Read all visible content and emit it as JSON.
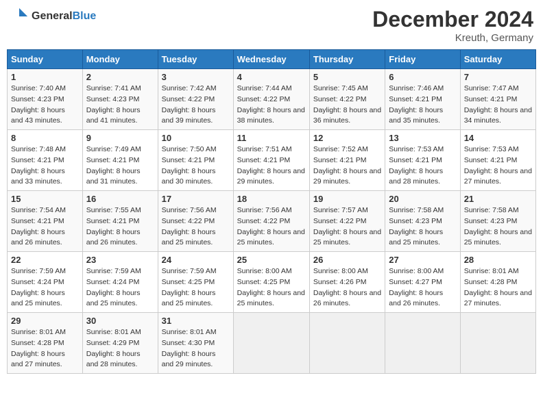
{
  "header": {
    "logo_general": "General",
    "logo_blue": "Blue",
    "month_title": "December 2024",
    "location": "Kreuth, Germany"
  },
  "weekdays": [
    "Sunday",
    "Monday",
    "Tuesday",
    "Wednesday",
    "Thursday",
    "Friday",
    "Saturday"
  ],
  "weeks": [
    [
      {
        "day": "1",
        "sunrise": "7:40 AM",
        "sunset": "4:23 PM",
        "daylight": "8 hours and 43 minutes."
      },
      {
        "day": "2",
        "sunrise": "7:41 AM",
        "sunset": "4:23 PM",
        "daylight": "8 hours and 41 minutes."
      },
      {
        "day": "3",
        "sunrise": "7:42 AM",
        "sunset": "4:22 PM",
        "daylight": "8 hours and 39 minutes."
      },
      {
        "day": "4",
        "sunrise": "7:44 AM",
        "sunset": "4:22 PM",
        "daylight": "8 hours and 38 minutes."
      },
      {
        "day": "5",
        "sunrise": "7:45 AM",
        "sunset": "4:22 PM",
        "daylight": "8 hours and 36 minutes."
      },
      {
        "day": "6",
        "sunrise": "7:46 AM",
        "sunset": "4:21 PM",
        "daylight": "8 hours and 35 minutes."
      },
      {
        "day": "7",
        "sunrise": "7:47 AM",
        "sunset": "4:21 PM",
        "daylight": "8 hours and 34 minutes."
      }
    ],
    [
      {
        "day": "8",
        "sunrise": "7:48 AM",
        "sunset": "4:21 PM",
        "daylight": "8 hours and 33 minutes."
      },
      {
        "day": "9",
        "sunrise": "7:49 AM",
        "sunset": "4:21 PM",
        "daylight": "8 hours and 31 minutes."
      },
      {
        "day": "10",
        "sunrise": "7:50 AM",
        "sunset": "4:21 PM",
        "daylight": "8 hours and 30 minutes."
      },
      {
        "day": "11",
        "sunrise": "7:51 AM",
        "sunset": "4:21 PM",
        "daylight": "8 hours and 29 minutes."
      },
      {
        "day": "12",
        "sunrise": "7:52 AM",
        "sunset": "4:21 PM",
        "daylight": "8 hours and 29 minutes."
      },
      {
        "day": "13",
        "sunrise": "7:53 AM",
        "sunset": "4:21 PM",
        "daylight": "8 hours and 28 minutes."
      },
      {
        "day": "14",
        "sunrise": "7:53 AM",
        "sunset": "4:21 PM",
        "daylight": "8 hours and 27 minutes."
      }
    ],
    [
      {
        "day": "15",
        "sunrise": "7:54 AM",
        "sunset": "4:21 PM",
        "daylight": "8 hours and 26 minutes."
      },
      {
        "day": "16",
        "sunrise": "7:55 AM",
        "sunset": "4:21 PM",
        "daylight": "8 hours and 26 minutes."
      },
      {
        "day": "17",
        "sunrise": "7:56 AM",
        "sunset": "4:22 PM",
        "daylight": "8 hours and 25 minutes."
      },
      {
        "day": "18",
        "sunrise": "7:56 AM",
        "sunset": "4:22 PM",
        "daylight": "8 hours and 25 minutes."
      },
      {
        "day": "19",
        "sunrise": "7:57 AM",
        "sunset": "4:22 PM",
        "daylight": "8 hours and 25 minutes."
      },
      {
        "day": "20",
        "sunrise": "7:58 AM",
        "sunset": "4:23 PM",
        "daylight": "8 hours and 25 minutes."
      },
      {
        "day": "21",
        "sunrise": "7:58 AM",
        "sunset": "4:23 PM",
        "daylight": "8 hours and 25 minutes."
      }
    ],
    [
      {
        "day": "22",
        "sunrise": "7:59 AM",
        "sunset": "4:24 PM",
        "daylight": "8 hours and 25 minutes."
      },
      {
        "day": "23",
        "sunrise": "7:59 AM",
        "sunset": "4:24 PM",
        "daylight": "8 hours and 25 minutes."
      },
      {
        "day": "24",
        "sunrise": "7:59 AM",
        "sunset": "4:25 PM",
        "daylight": "8 hours and 25 minutes."
      },
      {
        "day": "25",
        "sunrise": "8:00 AM",
        "sunset": "4:25 PM",
        "daylight": "8 hours and 25 minutes."
      },
      {
        "day": "26",
        "sunrise": "8:00 AM",
        "sunset": "4:26 PM",
        "daylight": "8 hours and 26 minutes."
      },
      {
        "day": "27",
        "sunrise": "8:00 AM",
        "sunset": "4:27 PM",
        "daylight": "8 hours and 26 minutes."
      },
      {
        "day": "28",
        "sunrise": "8:01 AM",
        "sunset": "4:28 PM",
        "daylight": "8 hours and 27 minutes."
      }
    ],
    [
      {
        "day": "29",
        "sunrise": "8:01 AM",
        "sunset": "4:28 PM",
        "daylight": "8 hours and 27 minutes."
      },
      {
        "day": "30",
        "sunrise": "8:01 AM",
        "sunset": "4:29 PM",
        "daylight": "8 hours and 28 minutes."
      },
      {
        "day": "31",
        "sunrise": "8:01 AM",
        "sunset": "4:30 PM",
        "daylight": "8 hours and 29 minutes."
      },
      null,
      null,
      null,
      null
    ]
  ]
}
